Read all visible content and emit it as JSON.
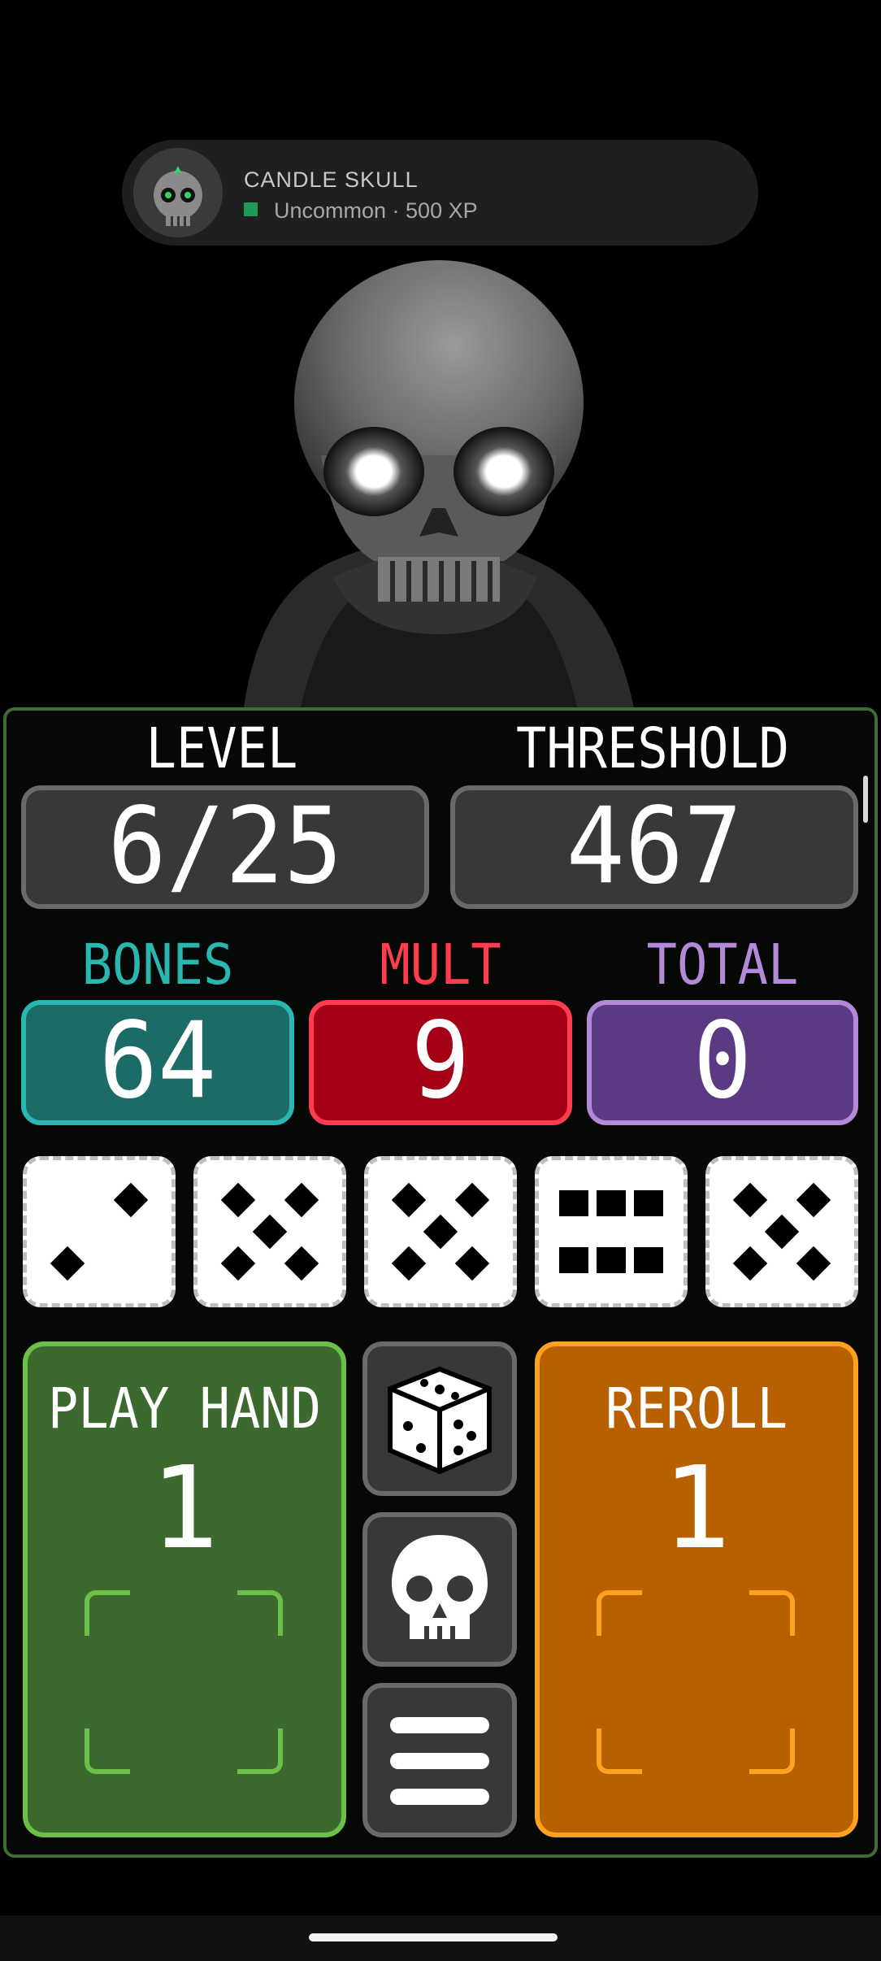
{
  "toast": {
    "title": "CANDLE SKULL",
    "subtitle": "Uncommon · 500 XP",
    "icon": "candle-skull-icon"
  },
  "stats": {
    "level_label": "LEVEL",
    "level_value": "6/25",
    "threshold_label": "THRESHOLD",
    "threshold_value": "467",
    "bones_label": "BONES",
    "bones_value": "64",
    "mult_label": "MULT",
    "mult_value": "9",
    "total_label": "TOTAL",
    "total_value": "0"
  },
  "dice": [
    2,
    5,
    5,
    6,
    5
  ],
  "actions": {
    "play_label": "PLAY HAND",
    "play_count": "1",
    "reroll_label": "REROLL",
    "reroll_count": "1"
  },
  "side_buttons": [
    "dice-icon",
    "skull-icon",
    "menu-icon"
  ],
  "colors": {
    "bones": "#2bb7b1",
    "mult": "#ff3d4f",
    "total": "#b28ad8",
    "play": "#6dbf4a",
    "reroll": "#ffa21f",
    "badge": "#1d9a55"
  }
}
